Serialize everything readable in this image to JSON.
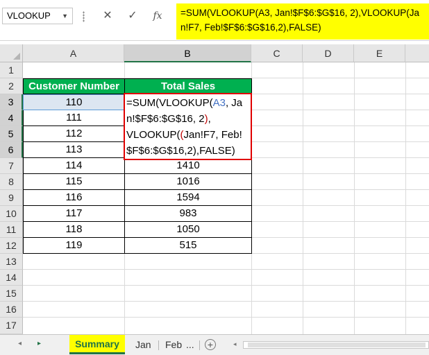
{
  "namebox": {
    "value": "VLOOKUP"
  },
  "formula_buttons": {
    "cancel": "✕",
    "enter": "✓",
    "fx": "fx"
  },
  "formula_bar": {
    "text": "=SUM(VLOOKUP(A3, Jan!$F$6:$G$16, 2),VLOOKUP(Jan!F7, Feb!$F$6:$G$16,2),FALSE)"
  },
  "columns": [
    "A",
    "B",
    "C",
    "D",
    "E"
  ],
  "rows": [
    "1",
    "2",
    "3",
    "4",
    "5",
    "6",
    "7",
    "8",
    "9",
    "10",
    "11",
    "12",
    "13",
    "14",
    "15",
    "16",
    "17"
  ],
  "table": {
    "headers": [
      "Customer Number",
      "Total Sales"
    ],
    "customer_numbers": [
      "110",
      "111",
      "112",
      "113",
      "114",
      "115",
      "116",
      "117",
      "118",
      "119"
    ],
    "total_sales": [
      "1410",
      "1016",
      "1594",
      "983",
      "1050",
      "515"
    ]
  },
  "editing_cell": {
    "parts": [
      "=SUM(VLOOKUP(",
      "A3",
      ", Jan!$F$6:$G$16, 2",
      ")",
      ",\nVLOOKUP(",
      "Jan!F7, Feb!$F$6:$G$16,2",
      "),FALSE)"
    ]
  },
  "sheet_tabs": {
    "active": "Summary",
    "others": [
      "Jan",
      "Feb"
    ],
    "more": "...",
    "add": "+"
  },
  "colors": {
    "header_green": "#00b050",
    "highlight_yellow": "#ffff00",
    "excel_green": "#217346",
    "edit_border_red": "#e00000"
  }
}
